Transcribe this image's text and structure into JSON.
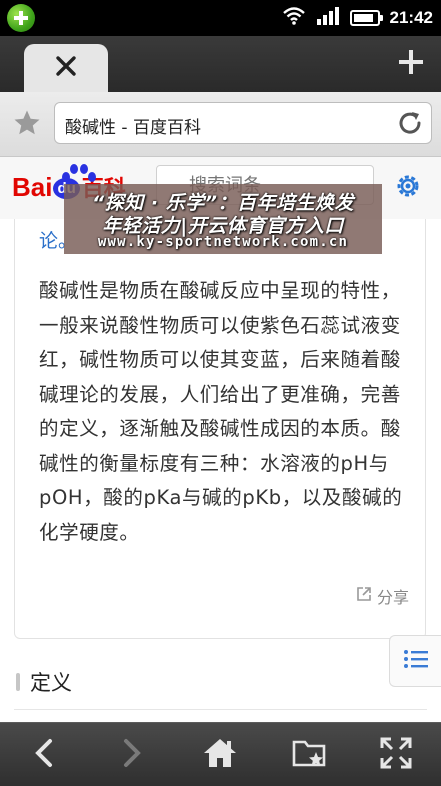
{
  "status_bar": {
    "time": "21:42",
    "battery_level": 0.9,
    "app_icon": "plus-circle-icon"
  },
  "tabs": {
    "close_icon": "close-icon",
    "new_tab_icon": "plus-icon"
  },
  "address_bar": {
    "title": "酸碱性 - 百度百科",
    "bookmark_icon": "star-icon",
    "reload_icon": "reload-icon"
  },
  "baidu_header": {
    "logo_bai": "Bai",
    "logo_du": "du",
    "logo_suffix": "百科",
    "search_placeholder": "搜索词条",
    "settings_icon": "gear-icon"
  },
  "article": {
    "link_tail": "论。",
    "paragraph": "酸碱性是物质在酸碱反应中呈现的特性，一般来说酸性物质可以使紫色石蕊试液变红，碱性物质可以使其变蓝，后来随着酸碱理论的发展，人们给出了更准确，完善的定义，逐渐触及酸碱性成因的本质。酸碱性的衡量标度有三种：水溶液的pH与pOH，酸的pKa与碱的pKb，以及酸碱的化学硬度。",
    "share_label": "分享",
    "section_title": "定义"
  },
  "overlay": {
    "line1": "“探知 · 乐学”：百年培生焕发",
    "line2": "年轻活力|开云体育官方入口",
    "line3": "www.ky-sportnetwork.com.cn"
  },
  "bottom_bar": {
    "back_icon": "back-arrow-icon",
    "forward_icon": "forward-arrow-icon",
    "home_icon": "home-icon",
    "bookmarks_icon": "folder-star-icon",
    "fullscreen_icon": "fullscreen-icon"
  },
  "colors": {
    "baidu_red": "#e10602",
    "baidu_blue": "#2932e1",
    "link_blue": "#2a6fc9"
  }
}
